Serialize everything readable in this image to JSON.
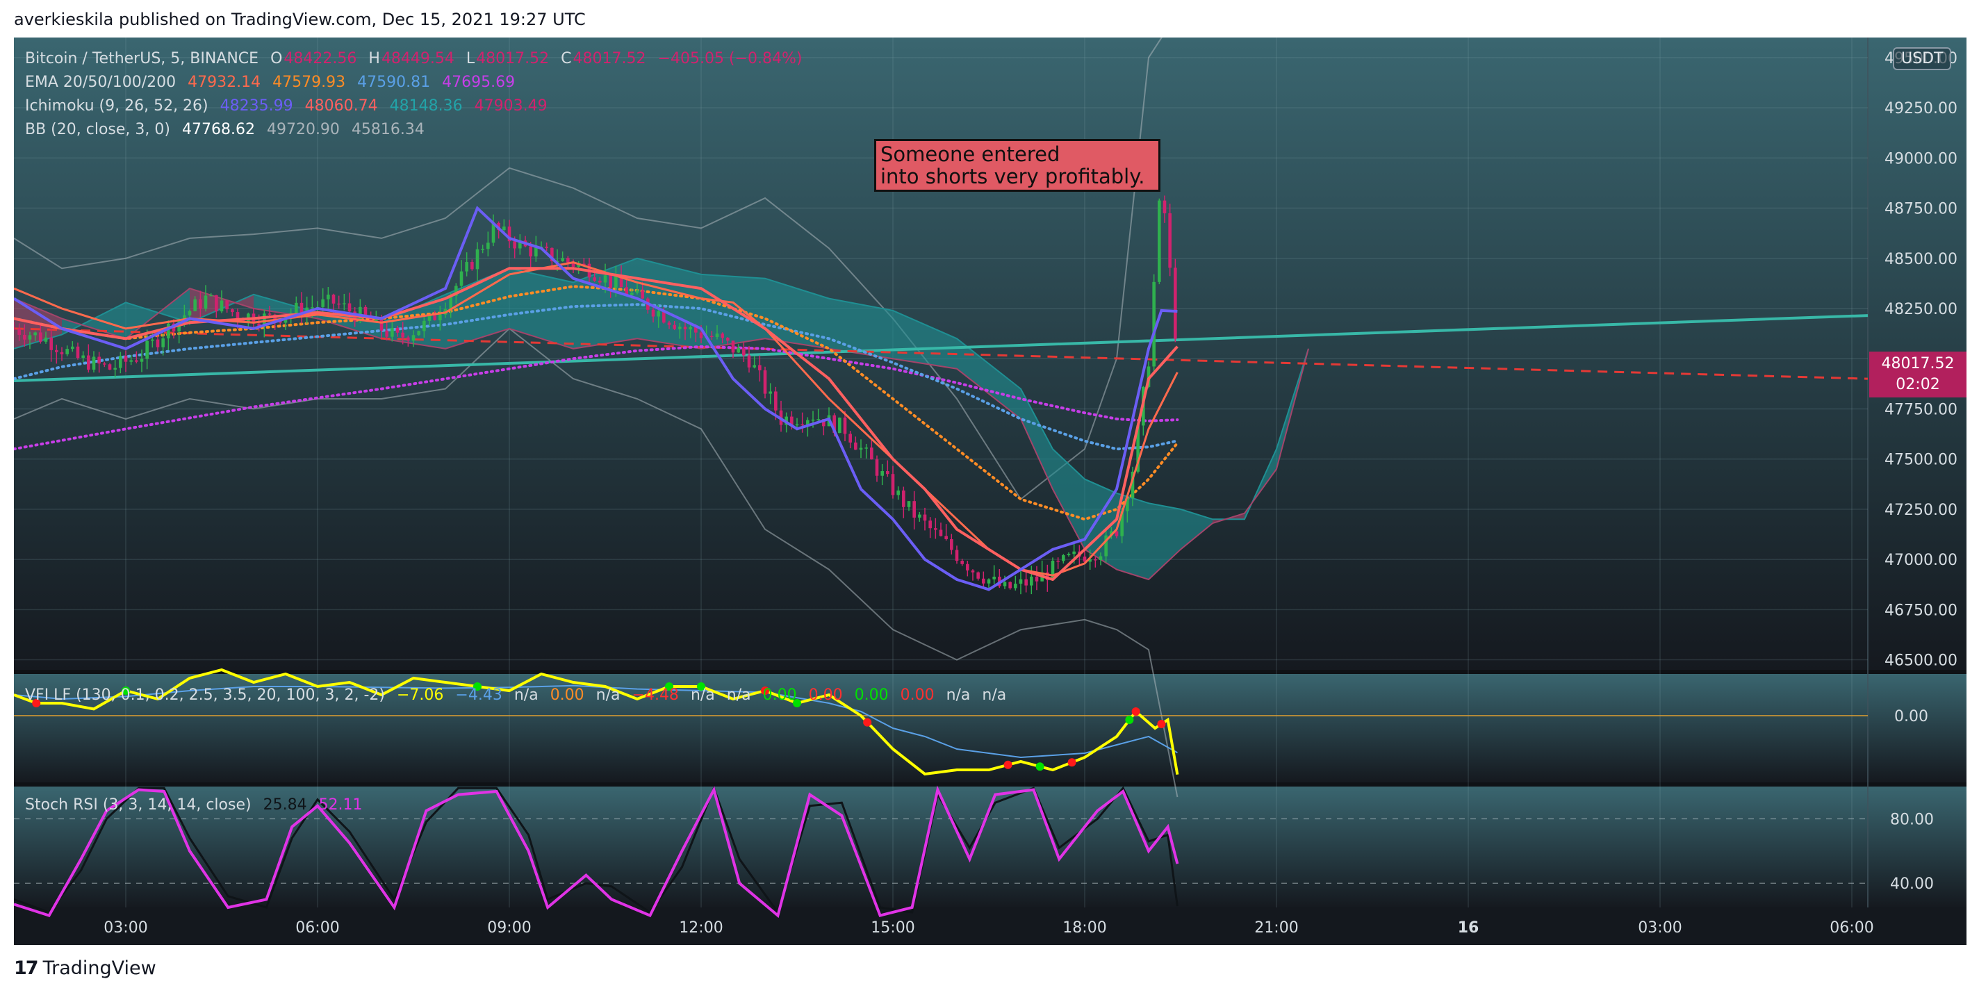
{
  "caption": "averkieskila published on TradingView.com, Dec 15, 2021 19:27 UTC",
  "footer": {
    "logo_mark": "17",
    "logo_text": "TradingView"
  },
  "colors": {
    "bg_top": "#3a6670",
    "bg_bottom": "#15191f",
    "candle_up": "#2fb14e",
    "candle_down": "#d1226e",
    "ema20": "#ff6a4d",
    "ema50": "#ff8c25",
    "ema100": "#5aa0e6",
    "ema200": "#c73ee8",
    "tenkan": "#6b5ef5",
    "kijun": "#ff6060",
    "cloud_bull": "#1f8f93",
    "cloud_bear": "#a3446a",
    "trendline": "#38b8a8",
    "dashed": "#e53935",
    "vfi": "#ffff00",
    "stoch_k": "#e033e6",
    "stoch_d": "#0f1418"
  },
  "legend": {
    "symbol": {
      "name": "Bitcoin / TetherUS, 5, BINANCE",
      "o_label": "O",
      "o": "48422.56",
      "h_label": "H",
      "h": "48449.54",
      "l_label": "L",
      "l": "48017.52",
      "c_label": "C",
      "c": "48017.52",
      "chg": "−405.05 (−0.84%)"
    },
    "ema": {
      "name": "EMA 20/50/100/200",
      "v1": "47932.14",
      "v2": "47579.93",
      "v3": "47590.81",
      "v4": "47695.69"
    },
    "ichimoku": {
      "name": "Ichimoku (9, 26, 52, 26)",
      "v1": "48235.99",
      "v2": "48060.74",
      "v3": "48148.36",
      "v4": "47903.49"
    },
    "bb": {
      "name": "BB (20, close, 3, 0)",
      "v1": "47768.62",
      "v2": "49720.90",
      "v3": "45816.34"
    },
    "vfi": {
      "name": "VFI LF (130, 0.1, 0.2, 2.5, 3.5, 20, 100, 3, 2, -2)",
      "v1": "−7.06",
      "v2": "−4.43",
      "v3": "n/a",
      "v4": "0.00",
      "v5": "n/a",
      "v6": "−4.48",
      "v7": "n/a",
      "v8": "n/a",
      "v9": "0.00",
      "v10": "0.00",
      "v11": "0.00",
      "v12": "0.00",
      "v13": "n/a",
      "v14": "n/a"
    },
    "stoch": {
      "name": "Stoch RSI (3, 3, 14, 14, close)",
      "k": "25.84",
      "d": "52.11"
    }
  },
  "currency_badge": "USDT",
  "price_label": {
    "price": "48017.52",
    "countdown": "02:02"
  },
  "annotation": {
    "line1": "Someone entered",
    "line2": "into shorts very profitably."
  },
  "chart_data": {
    "type": "line",
    "price_axis": {
      "ylim": [
        46450,
        49600
      ],
      "ticks": [
        46500,
        46750,
        47000,
        47250,
        47500,
        47750,
        48000,
        48250,
        48500,
        48750,
        49000,
        49250,
        49500
      ],
      "tick_labels": [
        "46500.00",
        "46750.00",
        "47000.00",
        "47250.00",
        "47500.00",
        "47750.00",
        "48000.00",
        "48250.00",
        "48500.00",
        "48750.00",
        "49000.00",
        "49250.00",
        "49500.00"
      ]
    },
    "vfi_axis": {
      "ylim": [
        -8,
        5
      ],
      "ticks": [
        0
      ],
      "tick_labels": [
        "0.00"
      ]
    },
    "stoch_axis": {
      "ylim": [
        25,
        100
      ],
      "ticks": [
        40,
        80
      ],
      "tick_labels": [
        "40.00",
        "80.00"
      ]
    },
    "x_axis": {
      "xlim": [
        1.25,
        30.25
      ],
      "ticks": [
        3,
        6,
        9,
        12,
        15,
        18,
        21,
        24,
        27,
        30
      ],
      "tick_labels": [
        "03:00",
        "06:00",
        "09:00",
        "12:00",
        "15:00",
        "18:00",
        "21:00",
        "16",
        "03:00",
        "06:00"
      ]
    },
    "last_bar_hour": 19.45,
    "close": {
      "x": [
        1.25,
        1.75,
        2.25,
        2.75,
        3.25,
        3.75,
        4.25,
        4.75,
        5.25,
        5.75,
        6.25,
        6.75,
        7.25,
        7.75,
        8.25,
        8.75,
        9.25,
        9.75,
        10.25,
        10.75,
        11.25,
        11.75,
        12.25,
        12.75,
        13.25,
        13.75,
        14.25,
        14.75,
        15.25,
        15.75,
        16.25,
        16.75,
        17.25,
        17.75,
        18.25,
        18.5,
        18.75,
        19.0,
        19.2,
        19.45
      ],
      "y": [
        48150,
        48100,
        48000,
        47950,
        48020,
        48180,
        48300,
        48220,
        48200,
        48250,
        48280,
        48200,
        48100,
        48180,
        48400,
        48650,
        48550,
        48500,
        48450,
        48350,
        48250,
        48150,
        48100,
        48000,
        47700,
        47720,
        47650,
        47450,
        47250,
        47100,
        46950,
        46850,
        46900,
        47000,
        47050,
        47150,
        47450,
        48000,
        48900,
        48017.52
      ]
    },
    "ema20": {
      "x": [
        1.25,
        2,
        3,
        4,
        5,
        6,
        7,
        8,
        9,
        10,
        11,
        12,
        12.5,
        13,
        14,
        15,
        16,
        16.5,
        17,
        17.5,
        18,
        18.5,
        19,
        19.45
      ],
      "y": [
        48350,
        48250,
        48150,
        48200,
        48180,
        48220,
        48180,
        48230,
        48420,
        48480,
        48380,
        48300,
        48280,
        48150,
        47800,
        47500,
        47200,
        47050,
        46950,
        46920,
        46980,
        47150,
        47650,
        47932.14
      ]
    },
    "ema50": {
      "x": [
        1.25,
        2,
        3,
        4,
        5,
        6,
        7,
        8,
        9,
        10,
        11,
        12,
        13,
        14,
        15,
        16,
        17,
        18,
        18.5,
        19,
        19.45
      ],
      "y": [
        48200,
        48150,
        48100,
        48130,
        48150,
        48180,
        48200,
        48230,
        48310,
        48360,
        48340,
        48300,
        48200,
        48050,
        47800,
        47550,
        47300,
        47200,
        47250,
        47400,
        47579.93
      ]
    },
    "ema100": {
      "x": [
        1.25,
        2,
        3,
        4,
        5,
        6,
        7,
        8,
        9,
        10,
        11,
        12,
        13,
        14,
        15,
        16,
        17,
        18,
        18.5,
        19,
        19.45
      ],
      "y": [
        47900,
        47960,
        48010,
        48050,
        48080,
        48110,
        48140,
        48170,
        48220,
        48260,
        48270,
        48250,
        48170,
        48100,
        47980,
        47850,
        47700,
        47590,
        47550,
        47560,
        47590.81
      ]
    },
    "ema200": {
      "x": [
        1.25,
        3,
        5,
        7,
        9,
        10,
        11,
        12,
        13,
        14,
        15,
        16,
        17,
        18,
        18.5,
        19,
        19.45
      ],
      "y": [
        47550,
        47650,
        47760,
        47850,
        47950,
        48000,
        48040,
        48060,
        48050,
        48000,
        47950,
        47880,
        47800,
        47730,
        47700,
        47690,
        47695.69
      ]
    },
    "tenkan": {
      "x": [
        1.25,
        2,
        3,
        4,
        5,
        6,
        7,
        8,
        8.5,
        9,
        9.5,
        10,
        11,
        12,
        12.5,
        13,
        13.5,
        14,
        14.5,
        15,
        15.5,
        16,
        16.5,
        17,
        17.5,
        18,
        18.5,
        19,
        19.2,
        19.45
      ],
      "y": [
        48300,
        48150,
        48050,
        48200,
        48150,
        48250,
        48200,
        48350,
        48750,
        48600,
        48550,
        48400,
        48300,
        48150,
        47900,
        47750,
        47650,
        47700,
        47350,
        47200,
        47000,
        46900,
        46850,
        46950,
        47050,
        47100,
        47350,
        48050,
        48240,
        48235.99
      ]
    },
    "kijun": {
      "x": [
        1.25,
        2,
        3,
        4,
        5,
        6,
        7,
        8,
        9,
        10,
        11,
        12,
        13,
        14,
        14.5,
        15,
        15.5,
        16,
        16.5,
        17,
        17.5,
        18,
        18.5,
        19,
        19.45
      ],
      "y": [
        48200,
        48150,
        48100,
        48180,
        48200,
        48230,
        48200,
        48300,
        48450,
        48450,
        48400,
        48350,
        48150,
        47900,
        47700,
        47500,
        47350,
        47150,
        47050,
        46950,
        46900,
        47050,
        47200,
        47900,
        48060.74
      ]
    },
    "cloud": {
      "x": [
        1.25,
        2,
        3,
        4,
        5,
        6,
        7,
        8,
        9,
        10,
        11,
        12,
        13,
        14,
        15,
        16,
        17,
        17.5,
        18,
        18.5,
        19,
        19.5,
        20,
        20.5,
        21,
        21.5
      ],
      "span_a": [
        48050,
        48120,
        48280,
        48180,
        48320,
        48230,
        48180,
        48320,
        48450,
        48380,
        48500,
        48420,
        48400,
        48300,
        48240,
        48100,
        47850,
        47550,
        47400,
        47330,
        47280,
        47250,
        47200,
        47200,
        47550,
        48050
      ],
      "span_b": [
        48300,
        48200,
        48100,
        48350,
        48250,
        48200,
        48100,
        48050,
        48150,
        48050,
        48100,
        48050,
        48100,
        48050,
        48000,
        47950,
        47700,
        47350,
        47050,
        46950,
        46900,
        47050,
        47180,
        47230,
        47450,
        48050
      ]
    },
    "bb": {
      "x": [
        1.25,
        2,
        3,
        4,
        5,
        6,
        7,
        8,
        9,
        10,
        11,
        12,
        13,
        14,
        15,
        16,
        17,
        18,
        18.5,
        19,
        19.45
      ],
      "upper": [
        48600,
        48450,
        48500,
        48600,
        48620,
        48650,
        48600,
        48700,
        48950,
        48850,
        48700,
        48650,
        48800,
        48550,
        48200,
        47800,
        47300,
        47550,
        48000,
        49500,
        49720.9
      ],
      "lower": [
        47700,
        47800,
        47700,
        47800,
        47750,
        47800,
        47800,
        47850,
        48150,
        47900,
        47800,
        47650,
        47150,
        46950,
        46650,
        46500,
        46650,
        46700,
        46650,
        46550,
        45816.34
      ]
    },
    "trendline": {
      "x": [
        1.25,
        30.25
      ],
      "y": [
        47890,
        48215
      ]
    },
    "dashed": {
      "x": [
        1.25,
        30.25
      ],
      "y": [
        48150,
        47900
      ]
    },
    "vfi": {
      "x": [
        1.25,
        1.6,
        2,
        2.5,
        3,
        3.5,
        4,
        4.5,
        5,
        5.5,
        6,
        6.5,
        7,
        7.5,
        8,
        8.5,
        9,
        9.5,
        10,
        10.5,
        11,
        11.5,
        12,
        12.5,
        13,
        13.5,
        14,
        14.5,
        15,
        15.5,
        16,
        16.5,
        17,
        17.5,
        18,
        18.5,
        18.8,
        19.1,
        19.3,
        19.45
      ],
      "y": [
        2.5,
        1.5,
        1.5,
        0.8,
        3.0,
        2.0,
        4.5,
        5.5,
        4.0,
        5.0,
        3.5,
        4.0,
        2.5,
        4.5,
        4.0,
        3.5,
        3.0,
        5.0,
        4.0,
        3.5,
        2.0,
        3.5,
        3.5,
        2.0,
        3.0,
        1.5,
        2.5,
        0.0,
        -4.0,
        -7.0,
        -6.5,
        -6.5,
        -5.5,
        -6.5,
        -5.0,
        -2.5,
        0.5,
        -1.5,
        -0.5,
        -7.06
      ]
    },
    "vfi_signal": {
      "x": [
        1.25,
        2,
        3,
        4,
        5,
        6,
        7,
        8,
        9,
        10,
        11,
        12,
        13,
        14,
        14.5,
        15,
        15.5,
        16,
        17,
        18,
        18.5,
        19,
        19.45
      ],
      "y": [
        2.5,
        2.0,
        2.3,
        3.0,
        3.5,
        3.5,
        3.4,
        3.3,
        3.4,
        3.6,
        3.2,
        3.0,
        2.8,
        1.5,
        0.5,
        -1.5,
        -2.5,
        -4.0,
        -5.0,
        -4.5,
        -3.5,
        -2.5,
        -4.43
      ]
    },
    "vfi_buy_x": [
      3.0,
      8.5,
      11.5,
      12.0,
      13.5,
      17.3,
      18.7
    ],
    "vfi_sell_x": [
      1.6,
      13.0,
      14.6,
      16.8,
      17.8,
      18.8,
      19.2
    ],
    "stoch_k": {
      "x": [
        1.25,
        1.8,
        2.3,
        2.7,
        3.2,
        3.6,
        4.0,
        4.6,
        5.2,
        5.6,
        6.0,
        6.5,
        7.2,
        7.7,
        8.2,
        8.8,
        9.3,
        9.6,
        10.2,
        10.6,
        11.2,
        11.7,
        12.2,
        12.6,
        13.2,
        13.7,
        14.2,
        14.8,
        15.3,
        15.7,
        16.2,
        16.6,
        17.2,
        17.6,
        18.2,
        18.6,
        19.0,
        19.3,
        19.45
      ],
      "y": [
        27,
        20,
        55,
        85,
        98,
        97,
        60,
        25,
        30,
        75,
        88,
        65,
        25,
        85,
        95,
        97,
        60,
        25,
        45,
        30,
        20,
        60,
        98,
        40,
        20,
        95,
        82,
        20,
        25,
        98,
        55,
        95,
        98,
        55,
        85,
        97,
        60,
        75,
        52.11
      ]
    },
    "stoch_d": {
      "x": [
        1.25,
        1.8,
        2.3,
        2.7,
        3.2,
        3.6,
        4.0,
        4.6,
        5.2,
        5.6,
        6.0,
        6.5,
        7.2,
        7.7,
        8.2,
        8.8,
        9.3,
        9.6,
        10.2,
        10.6,
        11.2,
        11.7,
        12.2,
        12.6,
        13.2,
        13.7,
        14.2,
        14.8,
        15.3,
        15.7,
        16.2,
        16.6,
        17.2,
        17.6,
        18.2,
        18.6,
        19.0,
        19.3,
        19.45
      ],
      "y": [
        30,
        22,
        48,
        80,
        99,
        99,
        68,
        32,
        25,
        68,
        92,
        72,
        30,
        78,
        99,
        99,
        70,
        30,
        40,
        38,
        22,
        50,
        99,
        55,
        22,
        88,
        90,
        25,
        22,
        95,
        62,
        90,
        99,
        62,
        80,
        99,
        66,
        70,
        25.84
      ]
    }
  }
}
